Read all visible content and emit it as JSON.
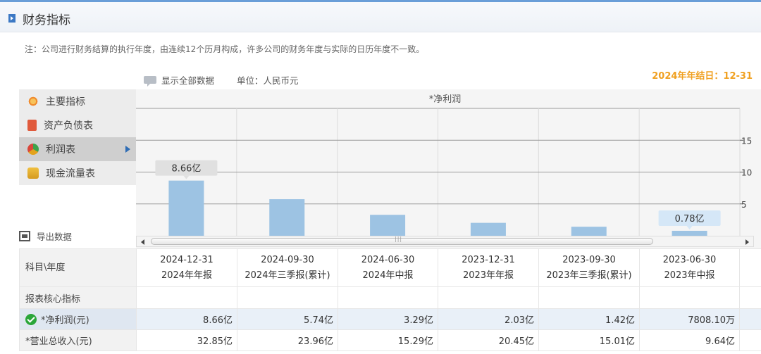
{
  "page": {
    "title": "财务指标",
    "note": "注：公司进行财务结算的执行年度，由连续12个历月构成，许多公司的财务年度与实际的日历年度不一致。",
    "show_all": "显示全部数据",
    "unit": "单位：人民币元",
    "year_end": "2024年年结日：12-31",
    "export": "导出数据"
  },
  "menu": [
    {
      "label": "主要指标",
      "icon": "gear-sun-icon"
    },
    {
      "label": "资产负债表",
      "icon": "document-icon"
    },
    {
      "label": "利润表",
      "icon": "pie-chart-icon",
      "active": true
    },
    {
      "label": "现金流量表",
      "icon": "coins-icon"
    }
  ],
  "chart_data": {
    "type": "bar",
    "title": "*净利润",
    "categories": [
      "2024-12-31",
      "2024-09-30",
      "2024-06-30",
      "2023-12-31",
      "2023-09-30",
      "2023-06-30"
    ],
    "values": [
      8.66,
      5.74,
      3.29,
      2.03,
      1.42,
      0.78
    ],
    "data_labels": [
      "8.66亿",
      "",
      "",
      "",
      "",
      "0.78亿"
    ],
    "yticks": [
      "5",
      "10",
      "15"
    ],
    "ylim": [
      0,
      20
    ],
    "grid": true,
    "color": "#9dc3e3",
    "label_bg": "#e0e0e0",
    "label_bg_last": "#d5e7f7"
  },
  "table": {
    "corner": "科目\\年度",
    "columns": [
      {
        "date": "2024-12-31",
        "report": "2024年年报"
      },
      {
        "date": "2024-09-30",
        "report": "2024年三季报(累计)"
      },
      {
        "date": "2024-06-30",
        "report": "2024年中报"
      },
      {
        "date": "2023-12-31",
        "report": "2023年年报"
      },
      {
        "date": "2023-09-30",
        "report": "2023年三季报(累计)"
      },
      {
        "date": "2023-06-30",
        "report": "2023年中报"
      }
    ],
    "section": "报表核心指标",
    "rows": [
      {
        "label": "*净利润(元)",
        "values": [
          "8.66亿",
          "5.74亿",
          "3.29亿",
          "2.03亿",
          "1.42亿",
          "7808.10万"
        ]
      },
      {
        "label": "*营业总收入(元)",
        "values": [
          "32.85亿",
          "23.96亿",
          "15.29亿",
          "20.45亿",
          "15.01亿",
          "9.64亿"
        ]
      }
    ]
  }
}
